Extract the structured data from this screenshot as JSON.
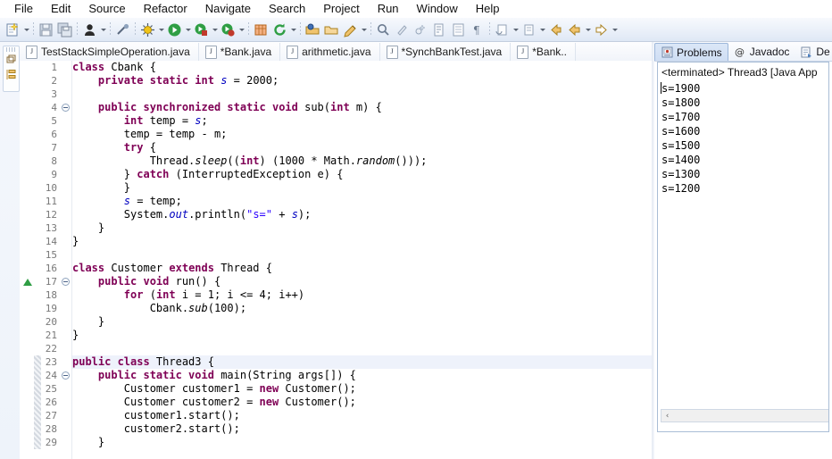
{
  "window": {
    "app": "Eclipse IDE"
  },
  "menubar": {
    "items": [
      {
        "label": "File",
        "name": "menu-file"
      },
      {
        "label": "Edit",
        "name": "menu-edit"
      },
      {
        "label": "Source",
        "name": "menu-source"
      },
      {
        "label": "Refactor",
        "name": "menu-refactor"
      },
      {
        "label": "Navigate",
        "name": "menu-navigate"
      },
      {
        "label": "Search",
        "name": "menu-search"
      },
      {
        "label": "Project",
        "name": "menu-project"
      },
      {
        "label": "Run",
        "name": "menu-run"
      },
      {
        "label": "Window",
        "name": "menu-window"
      },
      {
        "label": "Help",
        "name": "menu-help"
      }
    ]
  },
  "toolbar": {
    "icons": [
      "new-wizard-icon",
      "new-wizard-dropdown",
      "save-icon",
      "save-all-icon",
      "person-icon",
      "person-dropdown",
      "skip-breakpoints-icon",
      "debug-icon",
      "debug-dropdown",
      "run-icon",
      "run-dropdown",
      "run-external-tools-icon",
      "run-external-dropdown",
      "coverage-icon",
      "coverage-dropdown",
      "new-java-project-icon",
      "refresh-icon",
      "refresh-dropdown",
      "open-type-icon",
      "open-task-icon",
      "open-resource-icon",
      "open-resource-dropdown",
      "search-icon",
      "annotation-icon",
      "next-annotation-icon",
      "toggle-mark-occurrences-icon",
      "show-whitespace-icon",
      "pilcrow-icon",
      "previous-edit-icon",
      "previous-edit-dropdown",
      "next-edit-icon",
      "next-edit-dropdown",
      "back-history-icon",
      "back-icon",
      "back-dropdown",
      "forward-icon",
      "forward-dropdown"
    ]
  },
  "fastview": {
    "icons": [
      "restore-view-icon",
      "outline-view-icon"
    ]
  },
  "editor": {
    "tabs": [
      {
        "label": "TestStackSimpleOperation.java",
        "dirty": false,
        "active": false,
        "name": "editor-tab-teststacksimpleoperation"
      },
      {
        "label": "*Bank.java",
        "dirty": true,
        "active": false,
        "name": "editor-tab-bank"
      },
      {
        "label": "arithmetic.java",
        "dirty": false,
        "active": false,
        "name": "editor-tab-arithmetic"
      },
      {
        "label": "*SynchBankTest.java",
        "dirty": true,
        "active": false,
        "name": "editor-tab-synchbanktest"
      },
      {
        "label": "*Bank..",
        "dirty": true,
        "active": false,
        "name": "editor-tab-bank-2"
      }
    ],
    "current_line": 23,
    "lines": [
      {
        "n": 1,
        "fold": false,
        "warn": false,
        "changed": false,
        "tokens": [
          {
            "t": "class ",
            "c": "k"
          },
          {
            "t": "Cbank {",
            "c": ""
          }
        ]
      },
      {
        "n": 2,
        "fold": false,
        "warn": false,
        "changed": false,
        "tokens": [
          {
            "t": "    ",
            "c": ""
          },
          {
            "t": "private static int ",
            "c": "k"
          },
          {
            "t": "s",
            "c": "f"
          },
          {
            "t": " = 2000;",
            "c": ""
          }
        ]
      },
      {
        "n": 3,
        "fold": false,
        "warn": false,
        "changed": false,
        "tokens": []
      },
      {
        "n": 4,
        "fold": true,
        "warn": false,
        "changed": false,
        "tokens": [
          {
            "t": "    ",
            "c": ""
          },
          {
            "t": "public synchronized static void ",
            "c": "k"
          },
          {
            "t": "sub(",
            "c": ""
          },
          {
            "t": "int",
            "c": "k"
          },
          {
            "t": " m) {",
            "c": ""
          }
        ]
      },
      {
        "n": 5,
        "fold": false,
        "warn": false,
        "changed": false,
        "tokens": [
          {
            "t": "        ",
            "c": ""
          },
          {
            "t": "int",
            "c": "k"
          },
          {
            "t": " temp = ",
            "c": ""
          },
          {
            "t": "s",
            "c": "f"
          },
          {
            "t": ";",
            "c": ""
          }
        ]
      },
      {
        "n": 6,
        "fold": false,
        "warn": false,
        "changed": false,
        "tokens": [
          {
            "t": "        temp = temp - m;",
            "c": ""
          }
        ]
      },
      {
        "n": 7,
        "fold": false,
        "warn": false,
        "changed": false,
        "tokens": [
          {
            "t": "        ",
            "c": ""
          },
          {
            "t": "try",
            "c": "k"
          },
          {
            "t": " {",
            "c": ""
          }
        ]
      },
      {
        "n": 8,
        "fold": false,
        "warn": false,
        "changed": false,
        "tokens": [
          {
            "t": "            Thread.",
            "c": ""
          },
          {
            "t": "sleep",
            "c": "m"
          },
          {
            "t": "((",
            "c": ""
          },
          {
            "t": "int",
            "c": "k"
          },
          {
            "t": ") (1000 * Math.",
            "c": ""
          },
          {
            "t": "random",
            "c": "m"
          },
          {
            "t": "()));",
            "c": ""
          }
        ]
      },
      {
        "n": 9,
        "fold": false,
        "warn": false,
        "changed": false,
        "tokens": [
          {
            "t": "        } ",
            "c": ""
          },
          {
            "t": "catch",
            "c": "k"
          },
          {
            "t": " (InterruptedException e) {",
            "c": ""
          }
        ]
      },
      {
        "n": 10,
        "fold": false,
        "warn": false,
        "changed": false,
        "tokens": [
          {
            "t": "        }",
            "c": ""
          }
        ]
      },
      {
        "n": 11,
        "fold": false,
        "warn": false,
        "changed": false,
        "tokens": [
          {
            "t": "        ",
            "c": ""
          },
          {
            "t": "s",
            "c": "f"
          },
          {
            "t": " = temp;",
            "c": ""
          }
        ]
      },
      {
        "n": 12,
        "fold": false,
        "warn": false,
        "changed": false,
        "tokens": [
          {
            "t": "        System.",
            "c": ""
          },
          {
            "t": "out",
            "c": "f"
          },
          {
            "t": ".println(",
            "c": ""
          },
          {
            "t": "\"s=\"",
            "c": "s"
          },
          {
            "t": " + ",
            "c": ""
          },
          {
            "t": "s",
            "c": "f"
          },
          {
            "t": ");",
            "c": ""
          }
        ]
      },
      {
        "n": 13,
        "fold": false,
        "warn": false,
        "changed": false,
        "tokens": [
          {
            "t": "    }",
            "c": ""
          }
        ]
      },
      {
        "n": 14,
        "fold": false,
        "warn": false,
        "changed": false,
        "tokens": [
          {
            "t": "}",
            "c": ""
          }
        ]
      },
      {
        "n": 15,
        "fold": false,
        "warn": false,
        "changed": false,
        "tokens": []
      },
      {
        "n": 16,
        "fold": false,
        "warn": false,
        "changed": false,
        "tokens": [
          {
            "t": "class ",
            "c": "k"
          },
          {
            "t": "Customer ",
            "c": ""
          },
          {
            "t": "extends ",
            "c": "k"
          },
          {
            "t": "Thread {",
            "c": ""
          }
        ]
      },
      {
        "n": 17,
        "fold": true,
        "warn": true,
        "changed": false,
        "tokens": [
          {
            "t": "    ",
            "c": ""
          },
          {
            "t": "public void ",
            "c": "k"
          },
          {
            "t": "run() {",
            "c": ""
          }
        ]
      },
      {
        "n": 18,
        "fold": false,
        "warn": false,
        "changed": false,
        "tokens": [
          {
            "t": "        ",
            "c": ""
          },
          {
            "t": "for",
            "c": "k"
          },
          {
            "t": " (",
            "c": ""
          },
          {
            "t": "int",
            "c": "k"
          },
          {
            "t": " i = 1; i <= 4; i++)",
            "c": ""
          }
        ]
      },
      {
        "n": 19,
        "fold": false,
        "warn": false,
        "changed": false,
        "tokens": [
          {
            "t": "            Cbank.",
            "c": ""
          },
          {
            "t": "sub",
            "c": "m"
          },
          {
            "t": "(100);",
            "c": ""
          }
        ]
      },
      {
        "n": 20,
        "fold": false,
        "warn": false,
        "changed": false,
        "tokens": [
          {
            "t": "    }",
            "c": ""
          }
        ]
      },
      {
        "n": 21,
        "fold": false,
        "warn": false,
        "changed": false,
        "tokens": [
          {
            "t": "}",
            "c": ""
          }
        ]
      },
      {
        "n": 22,
        "fold": false,
        "warn": false,
        "changed": false,
        "tokens": []
      },
      {
        "n": 23,
        "fold": false,
        "warn": false,
        "changed": true,
        "tokens": [
          {
            "t": "public class ",
            "c": "k"
          },
          {
            "t": "Thread3 {",
            "c": ""
          }
        ]
      },
      {
        "n": 24,
        "fold": true,
        "warn": false,
        "changed": true,
        "tokens": [
          {
            "t": "    ",
            "c": ""
          },
          {
            "t": "public static void ",
            "c": "k"
          },
          {
            "t": "main(String args[]) {",
            "c": ""
          }
        ]
      },
      {
        "n": 25,
        "fold": false,
        "warn": false,
        "changed": true,
        "tokens": [
          {
            "t": "        Customer customer1 = ",
            "c": ""
          },
          {
            "t": "new",
            "c": "k"
          },
          {
            "t": " Customer();",
            "c": ""
          }
        ]
      },
      {
        "n": 26,
        "fold": false,
        "warn": false,
        "changed": true,
        "tokens": [
          {
            "t": "        Customer customer2 = ",
            "c": ""
          },
          {
            "t": "new",
            "c": "k"
          },
          {
            "t": " Customer();",
            "c": ""
          }
        ]
      },
      {
        "n": 27,
        "fold": false,
        "warn": false,
        "changed": true,
        "tokens": [
          {
            "t": "        customer1.start();",
            "c": ""
          }
        ]
      },
      {
        "n": 28,
        "fold": false,
        "warn": false,
        "changed": true,
        "tokens": [
          {
            "t": "        customer2.start();",
            "c": ""
          }
        ]
      },
      {
        "n": 29,
        "fold": false,
        "warn": false,
        "changed": true,
        "tokens": [
          {
            "t": "    }",
            "c": ""
          }
        ]
      }
    ]
  },
  "rightview": {
    "tabs": [
      {
        "label": "Problems",
        "icon": "problems-icon",
        "active": true,
        "name": "view-tab-problems"
      },
      {
        "label": "Javadoc",
        "icon": "javadoc-at-icon",
        "active": false,
        "name": "view-tab-javadoc"
      },
      {
        "label": "De",
        "icon": "declaration-icon",
        "active": false,
        "name": "view-tab-declaration"
      }
    ],
    "console": {
      "header": "<terminated> Thread3 [Java App",
      "lines": [
        "s=1900",
        "s=1800",
        "s=1700",
        "s=1600",
        "s=1500",
        "s=1400",
        "s=1300",
        "s=1200"
      ]
    },
    "scrollbar": {
      "left_arrow": "‹"
    }
  },
  "colors": {
    "keyword": "#7F0055",
    "string": "#2A00FF",
    "static_field": "#0000C0",
    "line_number": "#787878",
    "toolbar_bg": "#EAF0F9",
    "active_tab_bg": "#D3E1F4"
  }
}
